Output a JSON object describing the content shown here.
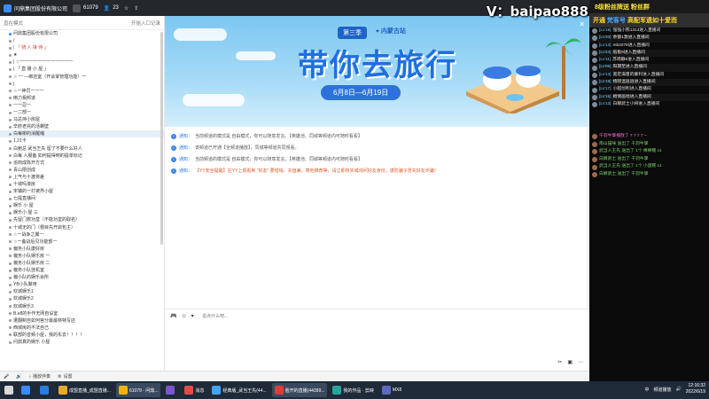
{
  "topbar": {
    "title": "问鼎集团股份有限公司",
    "count1": "61079",
    "count2": "23"
  },
  "sidebar": {
    "header_left": "直在模式",
    "header_right": "开始入口记录",
    "items": [
      {
        "label": "问鼎集团股份有限公司",
        "cls": "ch"
      },
      {
        "label": "/ ",
        "cls": ""
      },
      {
        "label": "| 「 骑 人 接 待 」",
        "cls": "red"
      },
      {
        "label": "★ ",
        "cls": ""
      },
      {
        "label": "| ☆一一一一一一一一一一一一 ",
        "cls": ""
      },
      {
        "label": "| 「 直 播 小 屋 」",
        "cls": ""
      },
      {
        "label": "☆ 一 —绑店室（开会掌管理功能）一",
        "cls": ""
      },
      {
        "label": "| ",
        "cls": ""
      },
      {
        "label": "☆一神罚一一一",
        "cls": ""
      },
      {
        "label": "倒力相邦道",
        "cls": ""
      },
      {
        "label": "一一忍一",
        "cls": ""
      },
      {
        "label": "一二部一",
        "cls": ""
      },
      {
        "label": "马总持小房屋",
        "cls": ""
      },
      {
        "label": "辛菸老完的活螺壁",
        "cls": ""
      },
      {
        "label": "白每柳的消醒缩",
        "cls": "sel"
      },
      {
        "label": "1.21卡",
        "cls": ""
      },
      {
        "label": "白鲍总 武当王先 留了不要什么好人",
        "cls": ""
      },
      {
        "label": "白每 人服备 如何提得倒的提单标记",
        "cls": ""
      },
      {
        "label": "追商成陈开方式",
        "cls": ""
      },
      {
        "label": "青山限创成",
        "cls": ""
      },
      {
        "label": "上气与十渡将差",
        "cls": ""
      },
      {
        "label": "十城吗滚房",
        "cls": ""
      },
      {
        "label": "宋镇的一打被界小屋",
        "cls": ""
      },
      {
        "label": "七提直播间",
        "cls": ""
      },
      {
        "label": "娱乐 小 屋",
        "cls": ""
      },
      {
        "label": "娱乐小 屋 三",
        "cls": ""
      },
      {
        "label": "先留门救功堂（不能功堂的取名）",
        "cls": ""
      },
      {
        "label": "十城无的门（根目先开启包主）",
        "cls": ""
      },
      {
        "label": "☆一战争之翼一",
        "cls": ""
      },
      {
        "label": "☆一备战后见功能部一",
        "cls": ""
      },
      {
        "label": "偏务小队康好房",
        "cls": ""
      },
      {
        "label": "偏务小队娱乐房 一",
        "cls": ""
      },
      {
        "label": "偏务小队娱乐房 二",
        "cls": ""
      },
      {
        "label": "偏务小队挂机室",
        "cls": ""
      },
      {
        "label": "偏小队的娱乐会所",
        "cls": ""
      },
      {
        "label": "YB小队聚用",
        "cls": ""
      },
      {
        "label": "欢城娱乐1",
        "cls": ""
      },
      {
        "label": "欢城娱乐2",
        "cls": ""
      },
      {
        "label": "欢城娱乐3",
        "cls": ""
      },
      {
        "label": "B.e8的手作无网自设室",
        "cls": ""
      },
      {
        "label": "遭翻制自如何宫分最最林特写店",
        "cls": ""
      },
      {
        "label": "西城房的不法自己",
        "cls": ""
      },
      {
        "label": "联部的音频小屋，我的东去！！！！",
        "cls": ""
      },
      {
        "label": "问鼎真的娱乐 小屋",
        "cls": ""
      }
    ]
  },
  "banner": {
    "season": "第三季",
    "location": "内蒙古站",
    "title": "带你去旅行",
    "date": "6月8日—6月19日"
  },
  "notices": [
    {
      "tag": "通知：",
      "text": "当前频道的模式是 自由模式，你可以随意发言。【英雄池、同城等频道内可随时看看】"
    },
    {
      "tag": "通知：",
      "text": "该频道已开通【全频道播放】，同城等频道共同观看。"
    },
    {
      "tag": "通知：",
      "text": "当前频道的模式是 自由模式，你可以随意发言。【英雄池、同城等频道内可随时看看】"
    },
    {
      "tag": "通知：",
      "text": "【YY安全提醒】在YY上观看到 \"好友\" 要借钱、充值兼、寄他推荐等，请立即核实或询问好友身份，谨防骗子冒充好友诈骗！"
    }
  ],
  "input": {
    "placeholder": "说点什么吧..."
  },
  "bottombar": {
    "items": [
      "播放伴奏",
      "设置"
    ]
  },
  "watermark": "V：baipao888",
  "right": {
    "banner1": "8级粉丝牌送 粉丝群",
    "banner2_a": "开通",
    "banner2_b": "梵客号",
    "banner2_c": "高配军遗如十爱而",
    "entries": [
      {
        "lv": "[LV19]",
        "text": "强强小熊1314进入直播间"
      },
      {
        "lv": "[LV20]",
        "text": "余额1激进入直播间"
      },
      {
        "lv": "[LV13]",
        "text": "mb3276进入直播间"
      },
      {
        "lv": "[LV24]",
        "text": "纸板9进入直播间"
      },
      {
        "lv": "[LV11]",
        "text": "苏雨静6进入直播间"
      },
      {
        "lv": "[LV05]",
        "text": "阳期至进入直播间"
      },
      {
        "lv": "[LV13]",
        "text": "宽宏海量的蒙利进入直播间"
      },
      {
        "lv": "[LV19]",
        "text": "杨晓温逍逍进入直播间"
      },
      {
        "lv": "[LV17]",
        "text": "小超创利进入直播间"
      },
      {
        "lv": "[LV15]",
        "text": "姆情画地进入直播间"
      },
      {
        "lv": "[LV13]",
        "text": "白鲸武士小将进入直播间"
      }
    ],
    "gifts": [
      {
        "text": "千羽牛掌播放了 7 7 7 7 ~",
        "cls": "hl"
      },
      {
        "text": "南山猫咪 送出了 千羽牛掌",
        "cls": ""
      },
      {
        "text": "武当人王先 送出了 1个 棒棒糖 x1",
        "cls": ""
      },
      {
        "text": "白鲸武士 送出了 千羽牛掌",
        "cls": ""
      },
      {
        "text": "武当人王先 送出了 1个 小蛋糕 x1",
        "cls": ""
      },
      {
        "text": "白鲸武士 送出了 千羽牛掌",
        "cls": ""
      }
    ]
  },
  "taskbar": {
    "apps": [
      {
        "label": "",
        "color": "#3b8bff"
      },
      {
        "label": "",
        "color": "#2a7de1"
      },
      {
        "label": "成盟直播_成盟直播...",
        "color": "#e6a92a"
      },
      {
        "label": "61079 · 问鼎...",
        "color": "#f0b400"
      },
      {
        "label": "",
        "color": "#7a55d1"
      },
      {
        "label": "消息",
        "color": "#e44b4b"
      },
      {
        "label": "经典版_武当王先(44...",
        "color": "#42a5f5"
      },
      {
        "label": "脸开的直播(44399...",
        "color": "#e53935"
      },
      {
        "label": "我的作品 · 剪映",
        "color": "#26a69a"
      },
      {
        "label": "MX8",
        "color": "#5c6bc0"
      }
    ],
    "tray_ime": "中",
    "tray_status": "频道播放",
    "time": "12:16:32",
    "date": "2022/6/19"
  },
  "colors": {
    "banner_blue": "#1f6fe0",
    "accent": "#3b83e8",
    "right_bg": "#0b0b0b"
  }
}
